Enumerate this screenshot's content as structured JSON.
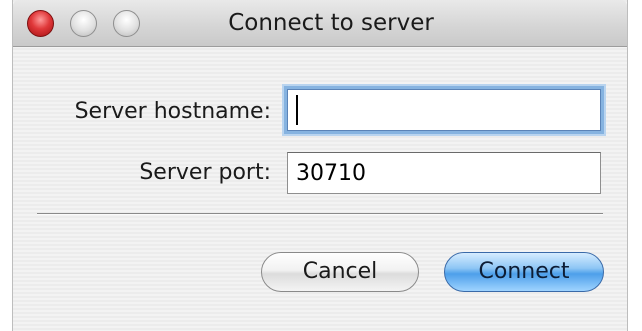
{
  "window": {
    "title": "Connect to server"
  },
  "form": {
    "hostname_label": "Server hostname:",
    "hostname_value": "",
    "port_label": "Server port:",
    "port_value": "30710"
  },
  "buttons": {
    "cancel_label": "Cancel",
    "connect_label": "Connect"
  },
  "colors": {
    "close_button": "#e0383a",
    "focus_ring": "#86b3e0",
    "default_button": "#4d9fea"
  }
}
